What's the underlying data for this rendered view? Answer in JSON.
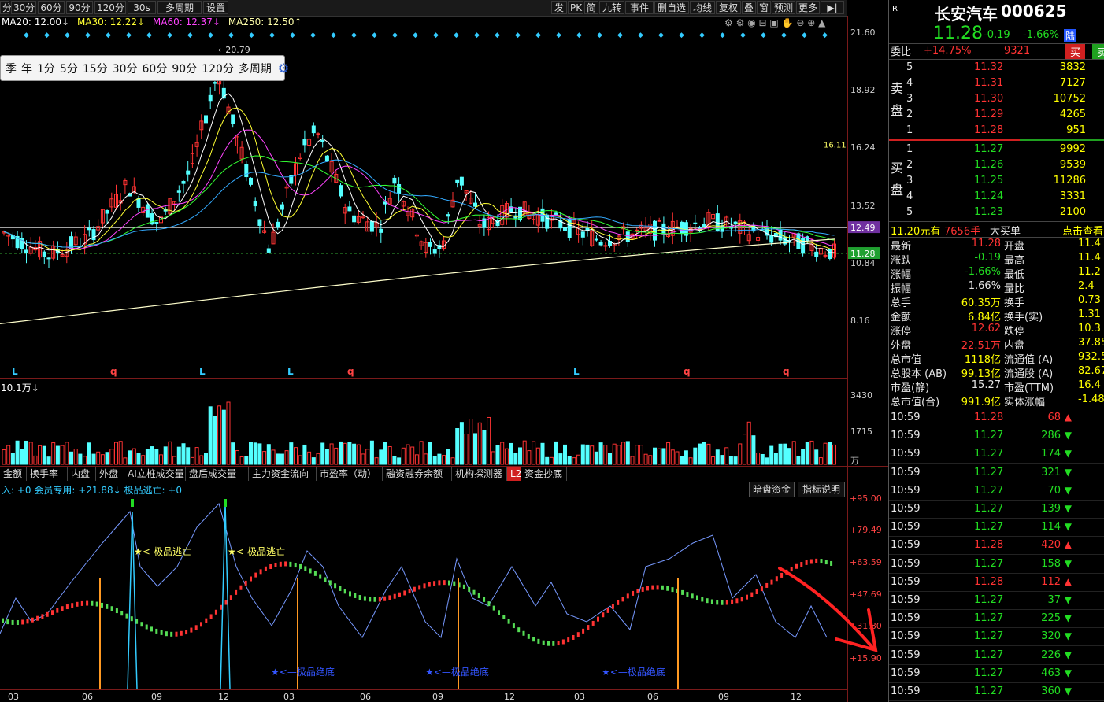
{
  "toolbar": {
    "left": [
      "分",
      "30分",
      "60分",
      "90分",
      "120分",
      "30s",
      "多周期",
      "设置"
    ],
    "right": [
      "发",
      "PK",
      "简",
      "九转",
      "事件",
      "删自选",
      "均线",
      "复权",
      "叠",
      "窗",
      "预测",
      "更多"
    ]
  },
  "ma": {
    "ma20": "MA20: 12.00↓",
    "ma30": "MA30: 12.22↓",
    "ma60": "MA60: 12.37↓",
    "ma250": "MA250: 12.50↑"
  },
  "period_popup": [
    "季",
    "年",
    "1分",
    "5分",
    "15分",
    "30分",
    "60分",
    "90分",
    "120分",
    "多周期"
  ],
  "price_axis": [
    "21.60",
    "18.92",
    "16.24",
    "13.52",
    "10.84",
    "8.16"
  ],
  "price_tags": {
    "hline1": "16.11",
    "hline2": "12.49",
    "current": "11.28",
    "high": "20.79"
  },
  "volume": {
    "label": "10.1万↓",
    "axis": [
      "3430",
      "1715",
      "万"
    ]
  },
  "indicator_tabs": [
    "金额",
    "换手率",
    "内盘",
    "外盘",
    "AI立桩成交量",
    "盘后成交量",
    "主力资金流向",
    "市盈率（动）",
    "融资融券余额",
    "机构探测器",
    "L2",
    "资金抄底"
  ],
  "indicator": {
    "header": "入: +0  会员专用: +21.88↓  极品逃亡: +0",
    "buttons": [
      "暗盘资金",
      "指标说明"
    ],
    "axis": [
      "+95.00",
      "+79.49",
      "+63.59",
      "+47.69",
      "+31.80",
      "+15.90"
    ],
    "escape_label": "<-极品逃亡",
    "bottom_label": "<—极品绝底"
  },
  "date_axis": [
    "03",
    "06",
    "09",
    "12",
    "03",
    "06",
    "09",
    "12",
    "03",
    "06",
    "09",
    "12"
  ],
  "markers": [
    "L",
    "q",
    "L",
    "L",
    "q",
    "L",
    "q",
    "q"
  ],
  "quote": {
    "name": "长安汽车",
    "code": "000625",
    "price": "11.28",
    "change": "-0.19",
    "change_pct": "-1.66%",
    "market_badge": "陆",
    "r_badge": "R",
    "weibi_label": "委比",
    "weibi": "+14.75%",
    "weicha": "9321",
    "buy_btn": "买",
    "sell_btn": "卖",
    "sell_side": "卖盘",
    "buy_side": "买盘",
    "asks": [
      {
        "lvl": "5",
        "p": "11.32",
        "v": "3832"
      },
      {
        "lvl": "4",
        "p": "11.31",
        "v": "7127"
      },
      {
        "lvl": "3",
        "p": "11.30",
        "v": "10752"
      },
      {
        "lvl": "2",
        "p": "11.29",
        "v": "4265"
      },
      {
        "lvl": "1",
        "p": "11.28",
        "v": "951"
      }
    ],
    "bids": [
      {
        "lvl": "1",
        "p": "11.27",
        "v": "9992"
      },
      {
        "lvl": "2",
        "p": "11.26",
        "v": "9539"
      },
      {
        "lvl": "3",
        "p": "11.25",
        "v": "11286"
      },
      {
        "lvl": "4",
        "p": "11.24",
        "v": "3331"
      },
      {
        "lvl": "5",
        "p": "11.23",
        "v": "2100"
      }
    ],
    "big_order": "11.20元有",
    "big_order_qty": "7656手",
    "big_order_type": "大买单",
    "big_order_link": "点击查看",
    "stats": [
      {
        "l1": "最新",
        "v1": "11.28",
        "c1": "red",
        "l2": "开盘",
        "v2": "11.4"
      },
      {
        "l1": "涨跌",
        "v1": "-0.19",
        "c1": "green",
        "l2": "最高",
        "v2": "11.4"
      },
      {
        "l1": "涨幅",
        "v1": "-1.66%",
        "c1": "green",
        "l2": "最低",
        "v2": "11.2"
      },
      {
        "l1": "振幅",
        "v1": "1.66%",
        "c1": "white",
        "l2": "量比",
        "v2": "2.4"
      },
      {
        "l1": "总手",
        "v1": "60.35万",
        "c1": "yellow",
        "l2": "换手",
        "v2": "0.73"
      },
      {
        "l1": "金额",
        "v1": "6.84亿",
        "c1": "yellow",
        "l2": "换手(实)",
        "v2": "1.31"
      },
      {
        "l1": "涨停",
        "v1": "12.62",
        "c1": "red",
        "l2": "跌停",
        "v2": "10.3"
      },
      {
        "l1": "外盘",
        "v1": "22.51万",
        "c1": "red",
        "l2": "内盘",
        "v2": "37.85"
      },
      {
        "l1": "总市值",
        "v1": "1118亿",
        "c1": "yellow",
        "l2": "流通值 (A)",
        "v2": "932.5"
      },
      {
        "l1": "总股本 (AB)",
        "v1": "99.13亿",
        "c1": "yellow",
        "l2": "流通股 (A)",
        "v2": "82.67"
      },
      {
        "l1": "市盈(静)",
        "v1": "15.27",
        "c1": "white",
        "l2": "市盈(TTM)",
        "v2": "16.4"
      },
      {
        "l1": "总市值(合)",
        "v1": "991.9亿",
        "c1": "yellow",
        "l2": "实体涨幅",
        "v2": "-1.48"
      }
    ],
    "ticks": [
      {
        "t": "10:59",
        "p": "11.28",
        "v": "68",
        "d": "up"
      },
      {
        "t": "10:59",
        "p": "11.27",
        "v": "286",
        "d": "down"
      },
      {
        "t": "10:59",
        "p": "11.27",
        "v": "174",
        "d": "down"
      },
      {
        "t": "10:59",
        "p": "11.27",
        "v": "321",
        "d": "down"
      },
      {
        "t": "10:59",
        "p": "11.27",
        "v": "70",
        "d": "down"
      },
      {
        "t": "10:59",
        "p": "11.27",
        "v": "139",
        "d": "down"
      },
      {
        "t": "10:59",
        "p": "11.27",
        "v": "114",
        "d": "down"
      },
      {
        "t": "10:59",
        "p": "11.28",
        "v": "420",
        "d": "up"
      },
      {
        "t": "10:59",
        "p": "11.27",
        "v": "158",
        "d": "down"
      },
      {
        "t": "10:59",
        "p": "11.28",
        "v": "112",
        "d": "up"
      },
      {
        "t": "10:59",
        "p": "11.27",
        "v": "37",
        "d": "down"
      },
      {
        "t": "10:59",
        "p": "11.27",
        "v": "225",
        "d": "down"
      },
      {
        "t": "10:59",
        "p": "11.27",
        "v": "320",
        "d": "down"
      },
      {
        "t": "10:59",
        "p": "11.27",
        "v": "226",
        "d": "down"
      },
      {
        "t": "10:59",
        "p": "11.27",
        "v": "463",
        "d": "down"
      },
      {
        "t": "10:59",
        "p": "11.27",
        "v": "360",
        "d": "down"
      }
    ]
  },
  "colors": {
    "up": "#ff3333",
    "down": "#22dd22",
    "candle_down": "#54ffff",
    "accent_yellow": "#ffff00"
  }
}
